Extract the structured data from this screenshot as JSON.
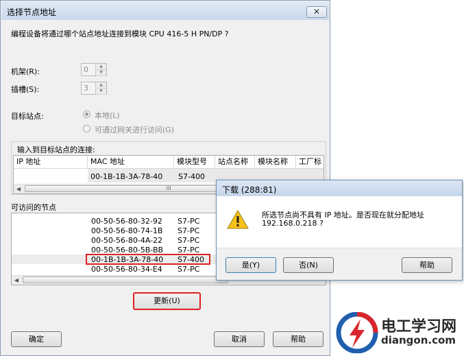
{
  "dialog": {
    "title": "选择节点地址",
    "close_label": "✕",
    "question": "编程设备将通过哪个站点地址连接到模块 CPU 416-5 H PN/DP ?",
    "rack_label": "机架(R):",
    "rack_value": "0",
    "slot_label": "插槽(S):",
    "slot_value": "3",
    "target_label": "目标站点:",
    "radio_local": "本地(L)",
    "radio_gateway": "可通过网关进行访问(G)",
    "input_group_label": "输入到目标站点的连接:",
    "columns": [
      "IP 地址",
      "MAC 地址",
      "模块型号",
      "站点名称",
      "模块名称",
      "工厂标"
    ],
    "input_row": {
      "ip": "",
      "mac": "00-1B-1B-3A-78-40",
      "type": "S7-400"
    },
    "scroll_thumb": "III",
    "accessible_label": "可访问的节点",
    "nodes": [
      {
        "mac": "00-50-56-80-32-92",
        "type": "S7-PC"
      },
      {
        "mac": "00-50-56-80-74-1B",
        "type": "S7-PC"
      },
      {
        "mac": "00-50-56-80-4A-22",
        "type": "S7-PC"
      },
      {
        "mac": "00-50-56-80-5B-BB",
        "type": "S7-PC"
      },
      {
        "mac": "00-1B-1B-3A-78-40",
        "type": "S7-400"
      },
      {
        "mac": "00-50-56-80-34-E4",
        "type": "S7-PC"
      }
    ],
    "update_button": "更新(U)",
    "ok_button": "确定",
    "cancel_button": "取消",
    "help_button": "帮助"
  },
  "popup": {
    "title": "下载 (288:81)",
    "message_line1": "所选节点尚不具有 IP 地址。是否现在就分配地址",
    "message_line2": "192.168.0.218 ?",
    "yes_button": "是(Y)",
    "no_button": "否(N)",
    "help_button": "帮助"
  },
  "logo": {
    "cn": "电工学习网",
    "en": "diangon.com"
  },
  "colors": {
    "highlight_red": "#e02020",
    "logo_red": "#d9262c",
    "logo_blue": "#1f5fae"
  }
}
